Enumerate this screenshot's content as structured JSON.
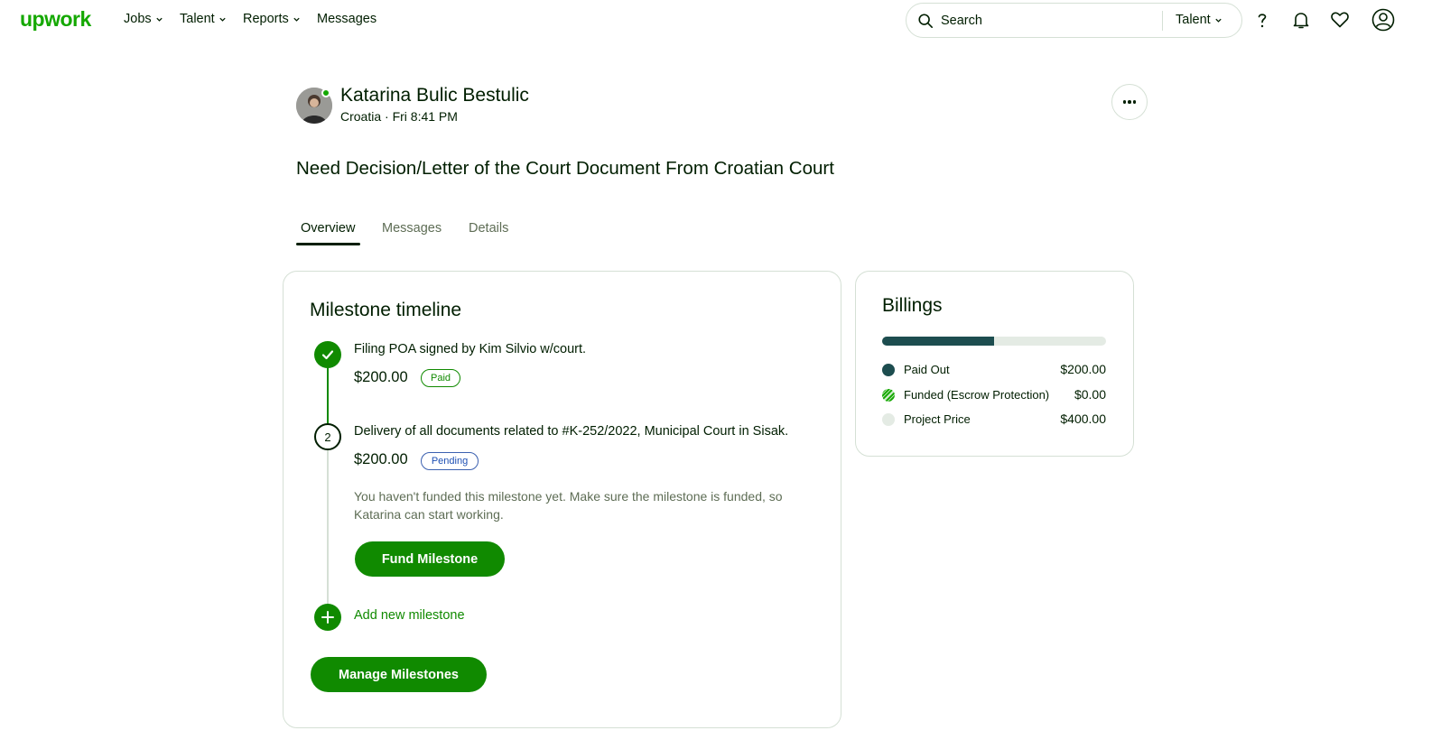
{
  "nav": {
    "logo": "upwork",
    "items": [
      {
        "label": "Jobs",
        "dropdown": true
      },
      {
        "label": "Talent",
        "dropdown": true
      },
      {
        "label": "Reports",
        "dropdown": true
      },
      {
        "label": "Messages",
        "dropdown": false
      }
    ],
    "search": {
      "placeholder": "Search",
      "scope": "Talent"
    },
    "icons": [
      "help-icon",
      "notification-bell-icon",
      "heart-icon",
      "user-account-icon"
    ]
  },
  "freelancer": {
    "name": "Katarina Bulic Bestulic",
    "meta": "Croatia · Fri 8:41 PM",
    "online": true
  },
  "contract": {
    "title": "Need Decision/Letter of the Court Document From Croatian Court"
  },
  "tabs": [
    {
      "label": "Overview",
      "active": true
    },
    {
      "label": "Messages",
      "active": false
    },
    {
      "label": "Details",
      "active": false
    }
  ],
  "milestones": {
    "title": "Milestone timeline",
    "items": [
      {
        "number": "1",
        "description": "Filing POA signed by Kim Silvio w/court.",
        "amount": "$200.00",
        "status": "Paid"
      },
      {
        "number": "2",
        "description": "Delivery of all documents related to #K-252/2022, Municipal Court in Sisak.",
        "amount": "$200.00",
        "status": "Pending",
        "note": "You haven't funded this milestone yet. Make sure the milestone is funded, so Katarina can start working.",
        "action": "Fund Milestone"
      }
    ],
    "add_label": "Add new milestone",
    "manage_label": "Manage Milestones"
  },
  "billings": {
    "title": "Billings",
    "progress_fraction": 0.5,
    "rows": [
      {
        "label": "Paid Out",
        "value": "$200.00",
        "color": "#1d4d4f"
      },
      {
        "label": "Funded (Escrow Protection)",
        "value": "$0.00",
        "color": "#14a800"
      },
      {
        "label": "Project Price",
        "value": "$400.00",
        "color": "#e4ebe4"
      }
    ]
  },
  "colors": {
    "brand_green": "#14a800",
    "button_green": "#108a00",
    "dark_teal": "#1d4d4f",
    "pending_blue": "#1d4fb3"
  }
}
